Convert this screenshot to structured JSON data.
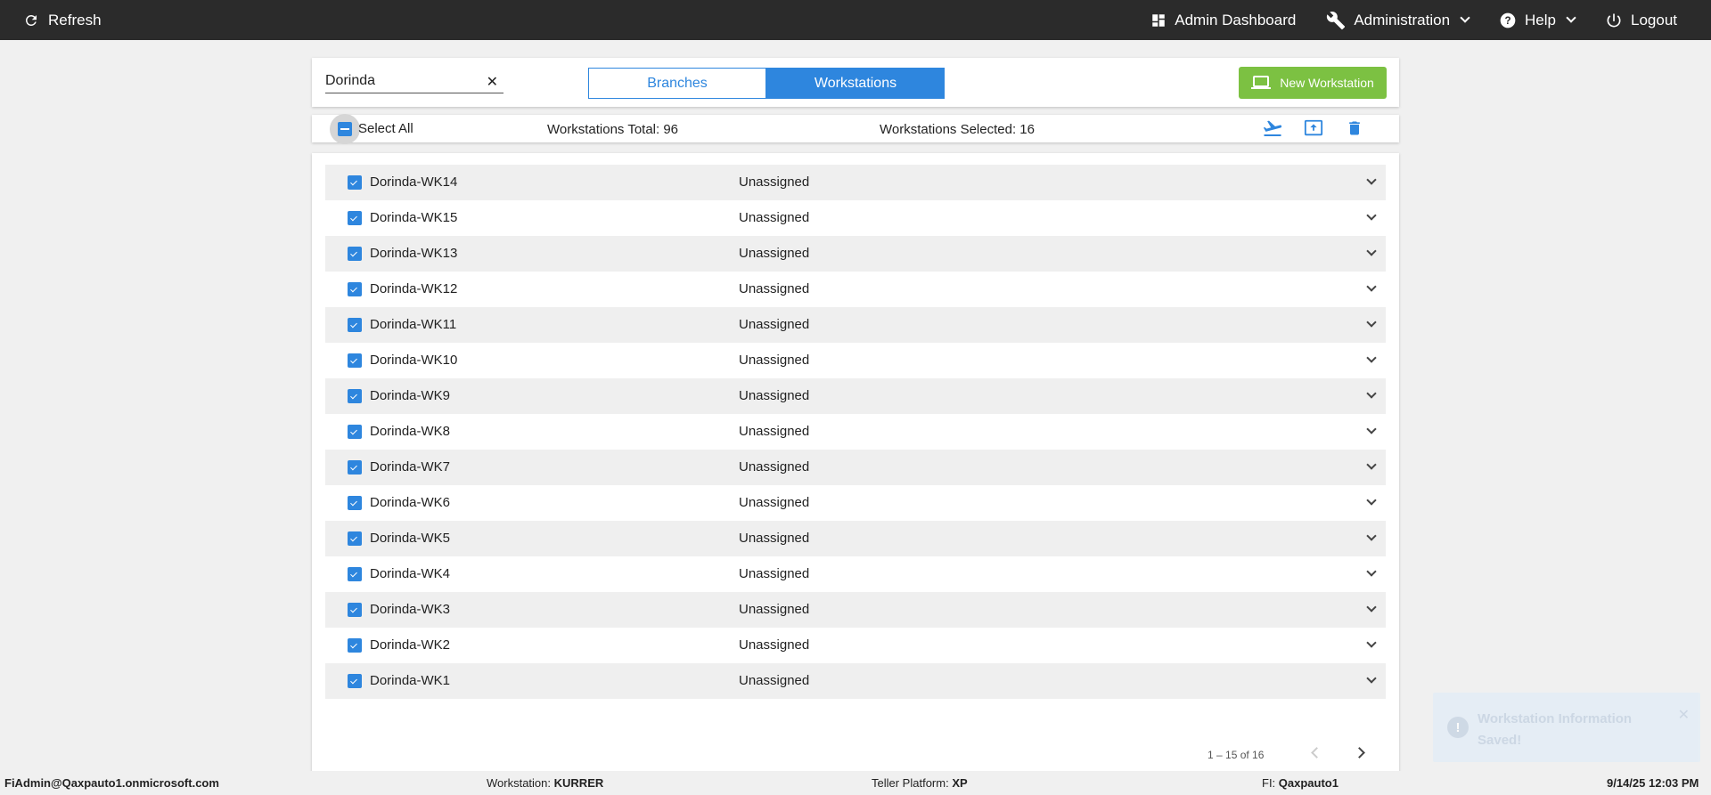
{
  "topbar": {
    "refresh_label": "Refresh",
    "admin_dashboard_label": "Admin Dashboard",
    "administration_label": "Administration",
    "help_label": "Help",
    "logout_label": "Logout"
  },
  "search": {
    "value": "Dorinda",
    "clear_label": "✕"
  },
  "tabs": {
    "branches_label": "Branches",
    "workstations_label": "Workstations",
    "active": "Workstations"
  },
  "new_workstation_label": "New Workstation",
  "action_bar": {
    "select_all_label": "Select All",
    "total_text": "Workstations Total: 96",
    "selected_text": "Workstations Selected: 16"
  },
  "rows": [
    {
      "name": "Dorinda-WK14",
      "status": "Unassigned"
    },
    {
      "name": "Dorinda-WK15",
      "status": "Unassigned"
    },
    {
      "name": "Dorinda-WK13",
      "status": "Unassigned"
    },
    {
      "name": "Dorinda-WK12",
      "status": "Unassigned"
    },
    {
      "name": "Dorinda-WK11",
      "status": "Unassigned"
    },
    {
      "name": "Dorinda-WK10",
      "status": "Unassigned"
    },
    {
      "name": "Dorinda-WK9",
      "status": "Unassigned"
    },
    {
      "name": "Dorinda-WK8",
      "status": "Unassigned"
    },
    {
      "name": "Dorinda-WK7",
      "status": "Unassigned"
    },
    {
      "name": "Dorinda-WK6",
      "status": "Unassigned"
    },
    {
      "name": "Dorinda-WK5",
      "status": "Unassigned"
    },
    {
      "name": "Dorinda-WK4",
      "status": "Unassigned"
    },
    {
      "name": "Dorinda-WK3",
      "status": "Unassigned"
    },
    {
      "name": "Dorinda-WK2",
      "status": "Unassigned"
    },
    {
      "name": "Dorinda-WK1",
      "status": "Unassigned"
    }
  ],
  "pager": {
    "range_text": "1 – 15 of 16"
  },
  "toast": {
    "message": "Workstation Information Saved!",
    "icon": "!",
    "close": "✕"
  },
  "footer": {
    "user": "FiAdmin@Qaxpauto1.onmicrosoft.com",
    "workstation_label": "Workstation:",
    "workstation_value": "KURRER",
    "teller_label": "Teller Platform:",
    "teller_value": "XP",
    "fi_label": "FI:",
    "fi_value": "Qaxpauto1",
    "datetime": "9/14/25 12:03 PM"
  },
  "colors": {
    "accent": "#2e86de",
    "success": "#7cc142",
    "topbar": "#2b2b2b"
  }
}
